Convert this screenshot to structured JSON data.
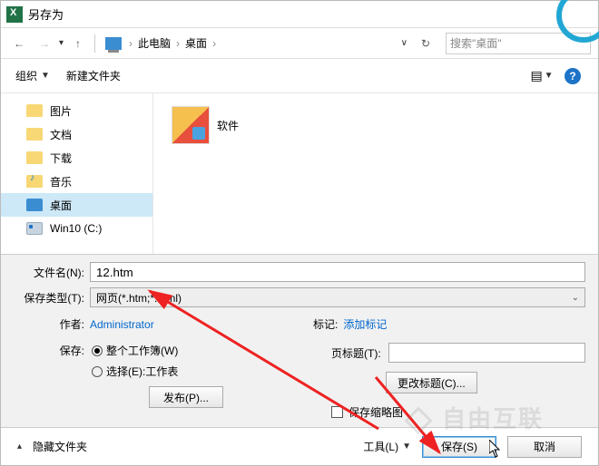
{
  "title": "另存为",
  "nav": {
    "crumb1": "此电脑",
    "crumb2": "桌面",
    "search_placeholder": "搜索\"桌面\""
  },
  "toolbar": {
    "organize": "组织",
    "new_folder": "新建文件夹"
  },
  "sidebar": {
    "items": [
      {
        "label": "图片"
      },
      {
        "label": "文档"
      },
      {
        "label": "下载"
      },
      {
        "label": "音乐"
      },
      {
        "label": "桌面"
      },
      {
        "label": "Win10 (C:)"
      }
    ]
  },
  "content": {
    "file1": "软件"
  },
  "form": {
    "filename_label": "文件名(N):",
    "filename_value": "12.htm",
    "filetype_label": "保存类型(T):",
    "filetype_value": "网页(*.htm;*.html)",
    "author_label": "作者:",
    "author_value": "Administrator",
    "tags_label": "标记:",
    "tags_value": "添加标记",
    "save_scope_label": "保存:",
    "radio_workbook": "整个工作簿(W)",
    "radio_selection": "选择(E):工作表",
    "publish_btn": "发布(P)...",
    "page_title_label": "页标题(T):",
    "change_title_btn": "更改标题(C)...",
    "save_thumbnail": "保存缩略图"
  },
  "footer": {
    "hide_folders": "隐藏文件夹",
    "tools": "工具(L)",
    "save": "保存(S)",
    "cancel": "取消"
  },
  "watermark": "自由互联"
}
